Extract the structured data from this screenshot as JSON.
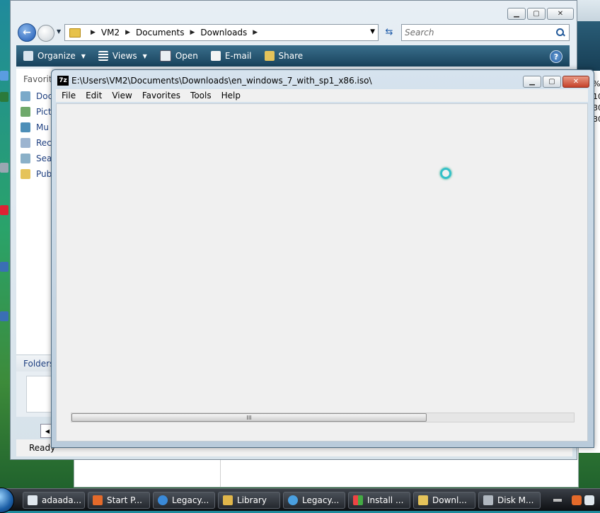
{
  "explorer": {
    "address": {
      "crumbs": [
        "VM2",
        "Documents",
        "Downloads"
      ]
    },
    "search_placeholder": "Search",
    "commands": {
      "organize": "Organize",
      "views": "Views",
      "open": "Open",
      "email": "E-mail",
      "share": "Share"
    },
    "help": "?",
    "nav": {
      "favorites": "Favorit",
      "items": [
        "Doc",
        "Pict",
        "Mu",
        "Rec",
        "Sea",
        "Pub"
      ]
    },
    "folders": "Folders",
    "status": "Ready"
  },
  "bg_right_numbers": [
    "%",
    "10",
    "30",
    "30"
  ],
  "zip": {
    "title": "E:\\Users\\VM2\\Documents\\Downloads\\en_windows_7_with_sp1_x86.iso\\",
    "logo": "7z",
    "menu": [
      "File",
      "Edit",
      "View",
      "Favorites",
      "Tools",
      "Help"
    ],
    "scroll_grip": "III"
  },
  "taskbar": {
    "buttons": [
      "adaada...",
      "Start P...",
      "Legacy...",
      "Library",
      "Legacy...",
      "Install ...",
      "Downl...",
      "Disk M..."
    ]
  },
  "colors": {
    "accent": "#1d58b4",
    "cmdbar": "#2a5d77",
    "close_red": "#c5412a"
  }
}
